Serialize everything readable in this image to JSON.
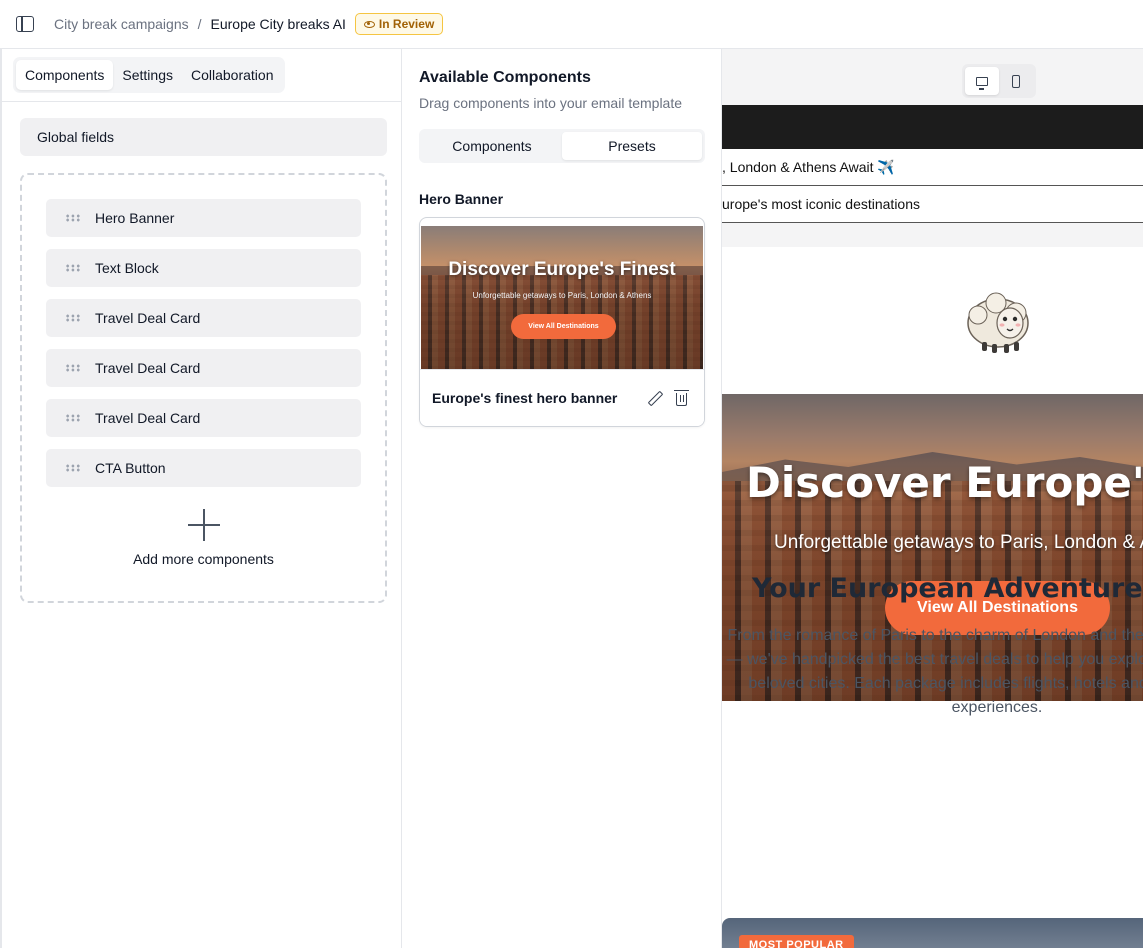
{
  "header": {
    "breadcrumb_parent": "City break campaigns",
    "breadcrumb_separator": "/",
    "breadcrumb_current": "Europe City breaks AI",
    "status_badge": "In Review"
  },
  "left_panel": {
    "tabs": [
      {
        "label": "Components",
        "active": true
      },
      {
        "label": "Settings",
        "active": false
      },
      {
        "label": "Collaboration",
        "active": false
      }
    ],
    "global_fields_label": "Global fields",
    "components": [
      {
        "label": "Hero Banner"
      },
      {
        "label": "Text Block"
      },
      {
        "label": "Travel Deal Card"
      },
      {
        "label": "Travel Deal Card"
      },
      {
        "label": "Travel Deal Card"
      },
      {
        "label": "CTA Button"
      }
    ],
    "add_more_label": "Add more components"
  },
  "middle_panel": {
    "title": "Available Components",
    "subtitle": "Drag components into your email template",
    "tabs": [
      {
        "label": "Components",
        "active": false
      },
      {
        "label": "Presets",
        "active": true
      }
    ],
    "section_label": "Hero Banner",
    "preset": {
      "thumb_title": "Discover Europe's Finest",
      "thumb_subtitle": "Unforgettable getaways to Paris, London & Athens",
      "thumb_button": "View All Destinations",
      "name": "Europe's finest hero banner"
    }
  },
  "preview": {
    "subject_line": ", London & Athens Await ✈️",
    "preheader": "urope's most iconic destinations",
    "hero_title": "Discover Europe's Finest",
    "hero_subtitle": "Unforgettable getaways to Paris, London & Athens",
    "hero_button": "View All Destinations",
    "section_title": "Your European Adventure Starts Here",
    "section_text": "From the romance of Paris to the charm of London and the history of Athens — we've handpicked the best travel deals to help you explore Europe's most beloved cities. Each package includes flights, hotels and unforgettable experiences.",
    "deal_badge": "MOST POPULAR"
  },
  "colors": {
    "accent": "#f26a3c",
    "badge_text": "#a16207",
    "badge_bg": "#fef9e7"
  }
}
